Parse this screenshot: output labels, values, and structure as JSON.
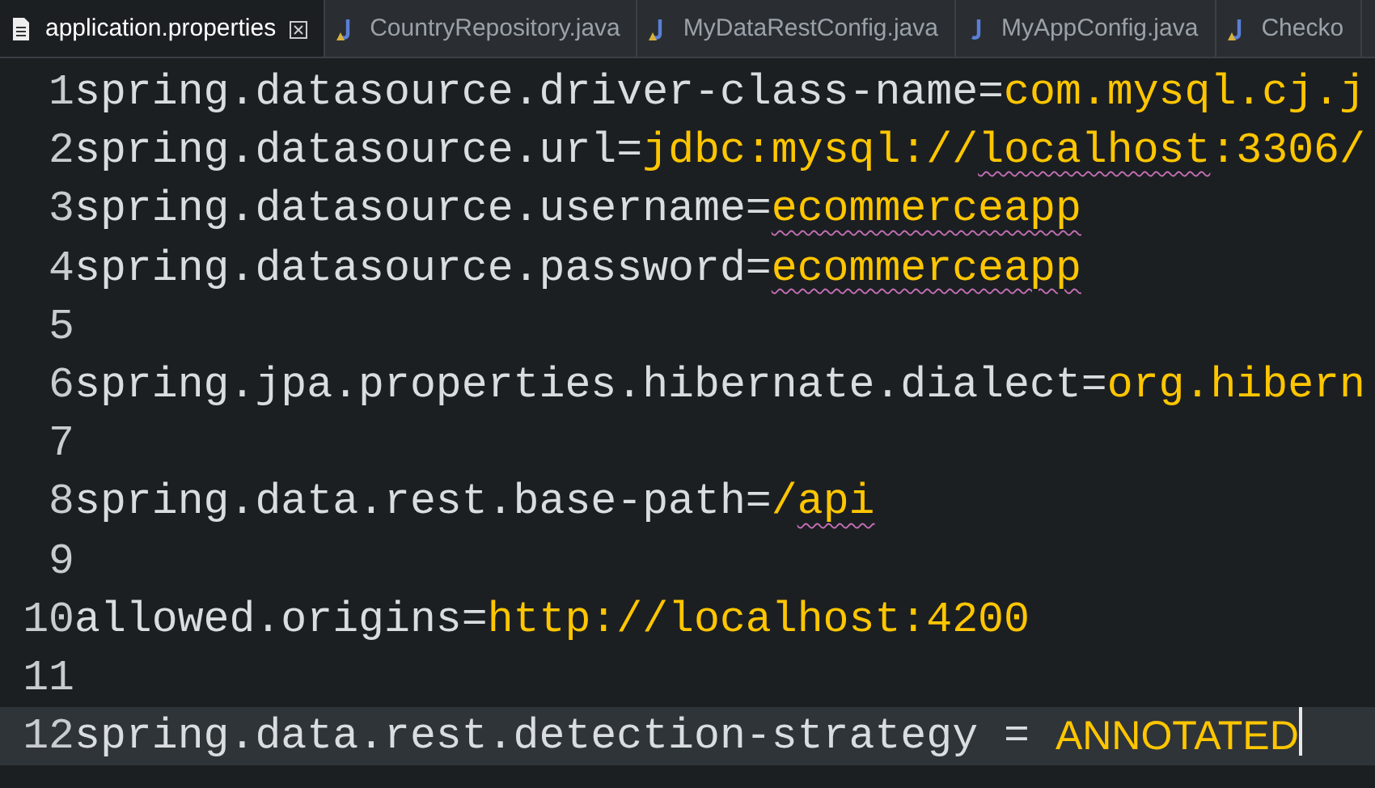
{
  "tabs": [
    {
      "label": "application.properties",
      "kind": "properties",
      "selected": true,
      "warning": false,
      "closable": true
    },
    {
      "label": "CountryRepository.java",
      "kind": "java",
      "selected": false,
      "warning": true,
      "closable": false
    },
    {
      "label": "MyDataRestConfig.java",
      "kind": "java",
      "selected": false,
      "warning": true,
      "closable": false
    },
    {
      "label": "MyAppConfig.java",
      "kind": "java",
      "selected": false,
      "warning": false,
      "closable": false
    },
    {
      "label": "Checko",
      "kind": "java",
      "selected": false,
      "warning": true,
      "closable": false
    }
  ],
  "lines": [
    {
      "number": "1",
      "key": "spring.datasource.driver-class-name",
      "separator": "=",
      "value": [
        {
          "text": "com.mysql.cj.j",
          "misspelled": false
        }
      ],
      "kind": "mono",
      "current": false
    },
    {
      "number": "2",
      "key": "spring.datasource.url",
      "separator": "=",
      "value": [
        {
          "text": "jdbc:mysql://",
          "misspelled": false
        },
        {
          "text": "localhost",
          "misspelled": true
        },
        {
          "text": ":3306/",
          "misspelled": false
        }
      ],
      "kind": "mono",
      "current": false
    },
    {
      "number": "3",
      "key": "spring.datasource.username",
      "separator": "=",
      "value": [
        {
          "text": "ecommerceapp",
          "misspelled": true
        }
      ],
      "kind": "mono",
      "current": false
    },
    {
      "number": "4",
      "key": "spring.datasource.password",
      "separator": "=",
      "value": [
        {
          "text": "ecommerceapp",
          "misspelled": true
        }
      ],
      "kind": "mono",
      "current": false
    },
    {
      "number": "5",
      "current": false
    },
    {
      "number": "6",
      "key": "spring.jpa.properties.hibernate.dialect",
      "separator": "=",
      "value": [
        {
          "text": "org.hibern",
          "misspelled": false
        }
      ],
      "kind": "mono",
      "current": false
    },
    {
      "number": "7",
      "current": false
    },
    {
      "number": "8",
      "key": "spring.data.rest.base-path",
      "separator": "=",
      "value": [
        {
          "text": "/",
          "misspelled": false
        },
        {
          "text": "api",
          "misspelled": true
        }
      ],
      "kind": "mono",
      "current": false
    },
    {
      "number": "9",
      "current": false
    },
    {
      "number": "10",
      "key": "allowed.origins",
      "separator": "=",
      "value": [
        {
          "text": "http://localhost:4200",
          "misspelled": false
        }
      ],
      "kind": "mono",
      "current": false
    },
    {
      "number": "11",
      "current": false
    },
    {
      "number": "12",
      "key": "spring.data.rest.detection-strategy",
      "separator": " = ",
      "value": [
        {
          "text": "ANNOTATED",
          "misspelled": false
        }
      ],
      "kind": "sans",
      "current": true
    }
  ]
}
